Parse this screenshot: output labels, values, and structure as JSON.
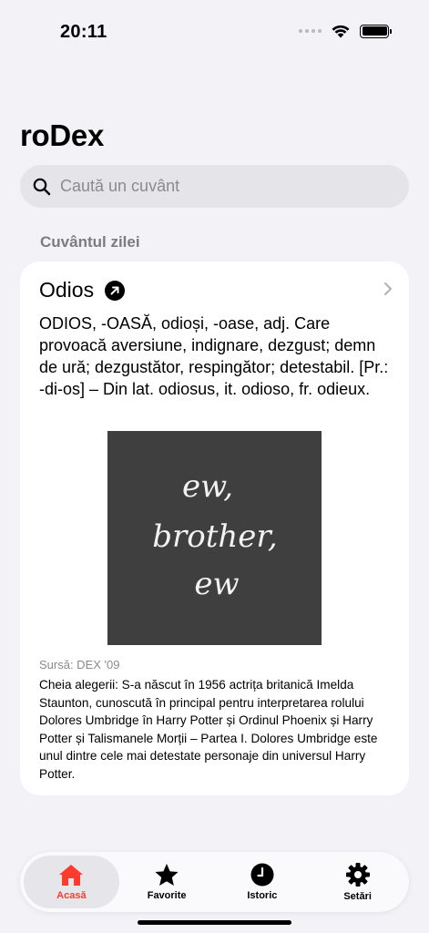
{
  "status_bar": {
    "time": "20:11"
  },
  "app": {
    "title": "roDex"
  },
  "search": {
    "placeholder": "Caută un cuvânt"
  },
  "section": {
    "label": "Cuvântul zilei"
  },
  "word_of_day": {
    "word": "Odios",
    "definition": "ODIOS, -OASĂ, odioși, -oase, adj. Care provoacă aversiune, indignare, dezgust; demn de ură; dezgustător, respingător; detestabil. [Pr.: -di-os] – Din lat. odiosus, it. odioso, fr. odieux.",
    "image": {
      "background_color": "#3f3f3f",
      "text_line1": "ew,",
      "text_line2": "brother,",
      "text_line3": "ew"
    },
    "source": "Sursă: DEX '09",
    "explanation": "Cheia alegerii: S-a născut în 1956 actrița britanică Imelda Staunton, cunoscută în principal pentru interpretarea rolului Dolores Umbridge în Harry Potter și Ordinul Phoenix și Harry Potter și Talismanele Morții – Partea I. Dolores Umbridge este unul dintre cele mai detestate personaje din universul Harry Potter."
  },
  "tabs": [
    {
      "label": "Acasă",
      "icon": "house-icon",
      "active": true
    },
    {
      "label": "Favorite",
      "icon": "star-icon",
      "active": false
    },
    {
      "label": "Istoric",
      "icon": "clock-icon",
      "active": false
    },
    {
      "label": "Setări",
      "icon": "gear-icon",
      "active": false
    }
  ],
  "colors": {
    "accent": "#ff3b30",
    "background": "#f2f2f7",
    "card": "#ffffff"
  }
}
